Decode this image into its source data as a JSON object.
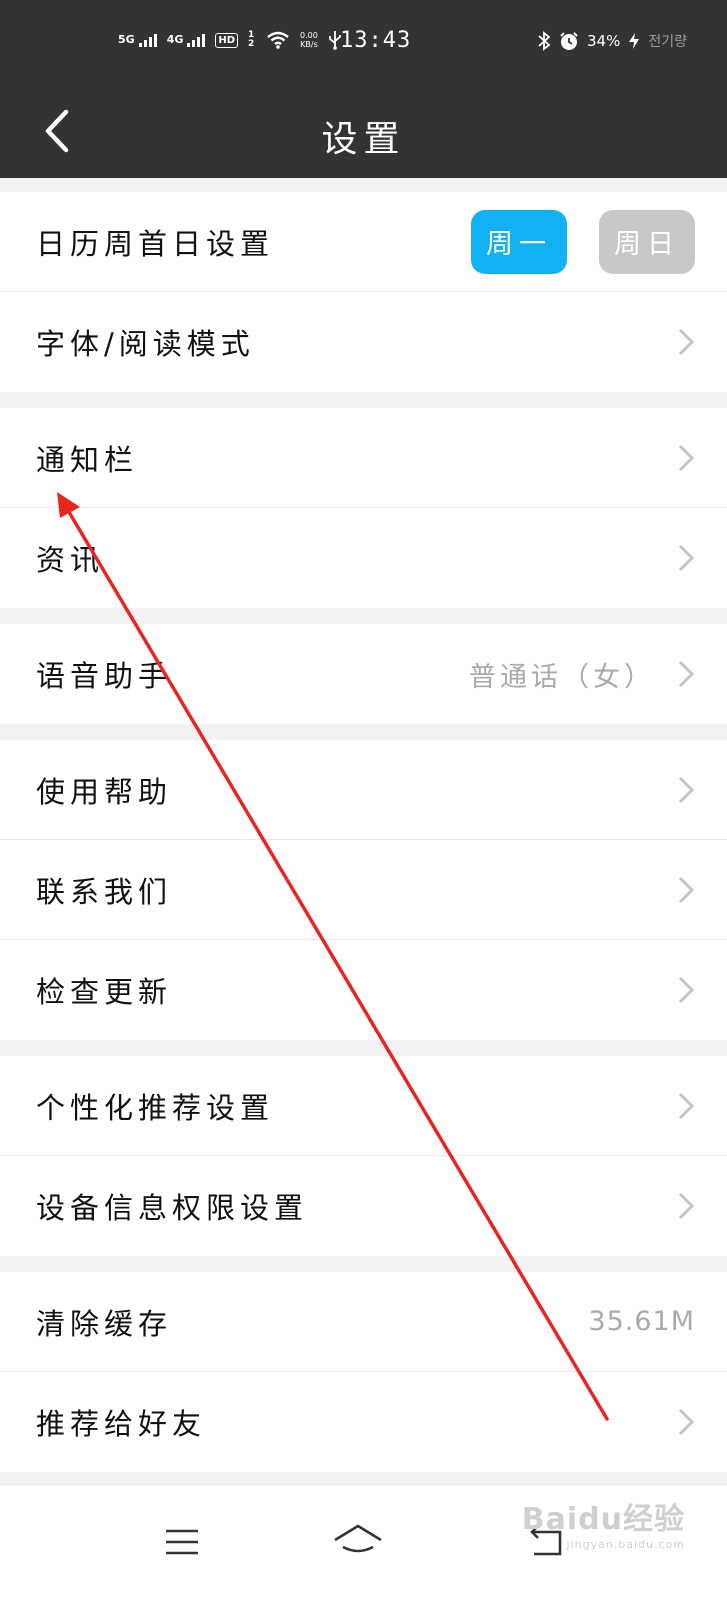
{
  "status_bar": {
    "sig1": "5G",
    "sig2": "4G",
    "hd": "HD",
    "hd_sub": "1 2",
    "net_speed": "0.00",
    "net_unit": "KB/s",
    "time": "13:43",
    "battery": "34%",
    "extra": "전기량"
  },
  "header": {
    "title": "设置"
  },
  "calendar": {
    "label": "日历周首日设置",
    "monday": "周一",
    "sunday": "周日",
    "selected": "周一"
  },
  "sections": {
    "font": {
      "label": "字体/阅读模式"
    },
    "notify": {
      "label": "通知栏"
    },
    "news": {
      "label": "资讯"
    },
    "voice": {
      "label": "语音助手",
      "value": "普通话（女）"
    },
    "help": {
      "label": "使用帮助"
    },
    "contact": {
      "label": "联系我们"
    },
    "update": {
      "label": "检查更新"
    },
    "personal": {
      "label": "个性化推荐设置"
    },
    "device": {
      "label": "设备信息权限设置"
    },
    "cache": {
      "label": "清除缓存",
      "value": "35.61M"
    },
    "share": {
      "label": "推荐给好友"
    }
  },
  "watermark": {
    "text": "Baidu经验",
    "sub": "jingyan.baidu.com"
  },
  "colors": {
    "header_bg": "#333333",
    "accent": "#12b1f4",
    "inactive": "#c8c8c8",
    "annotation": "#e8261e"
  }
}
